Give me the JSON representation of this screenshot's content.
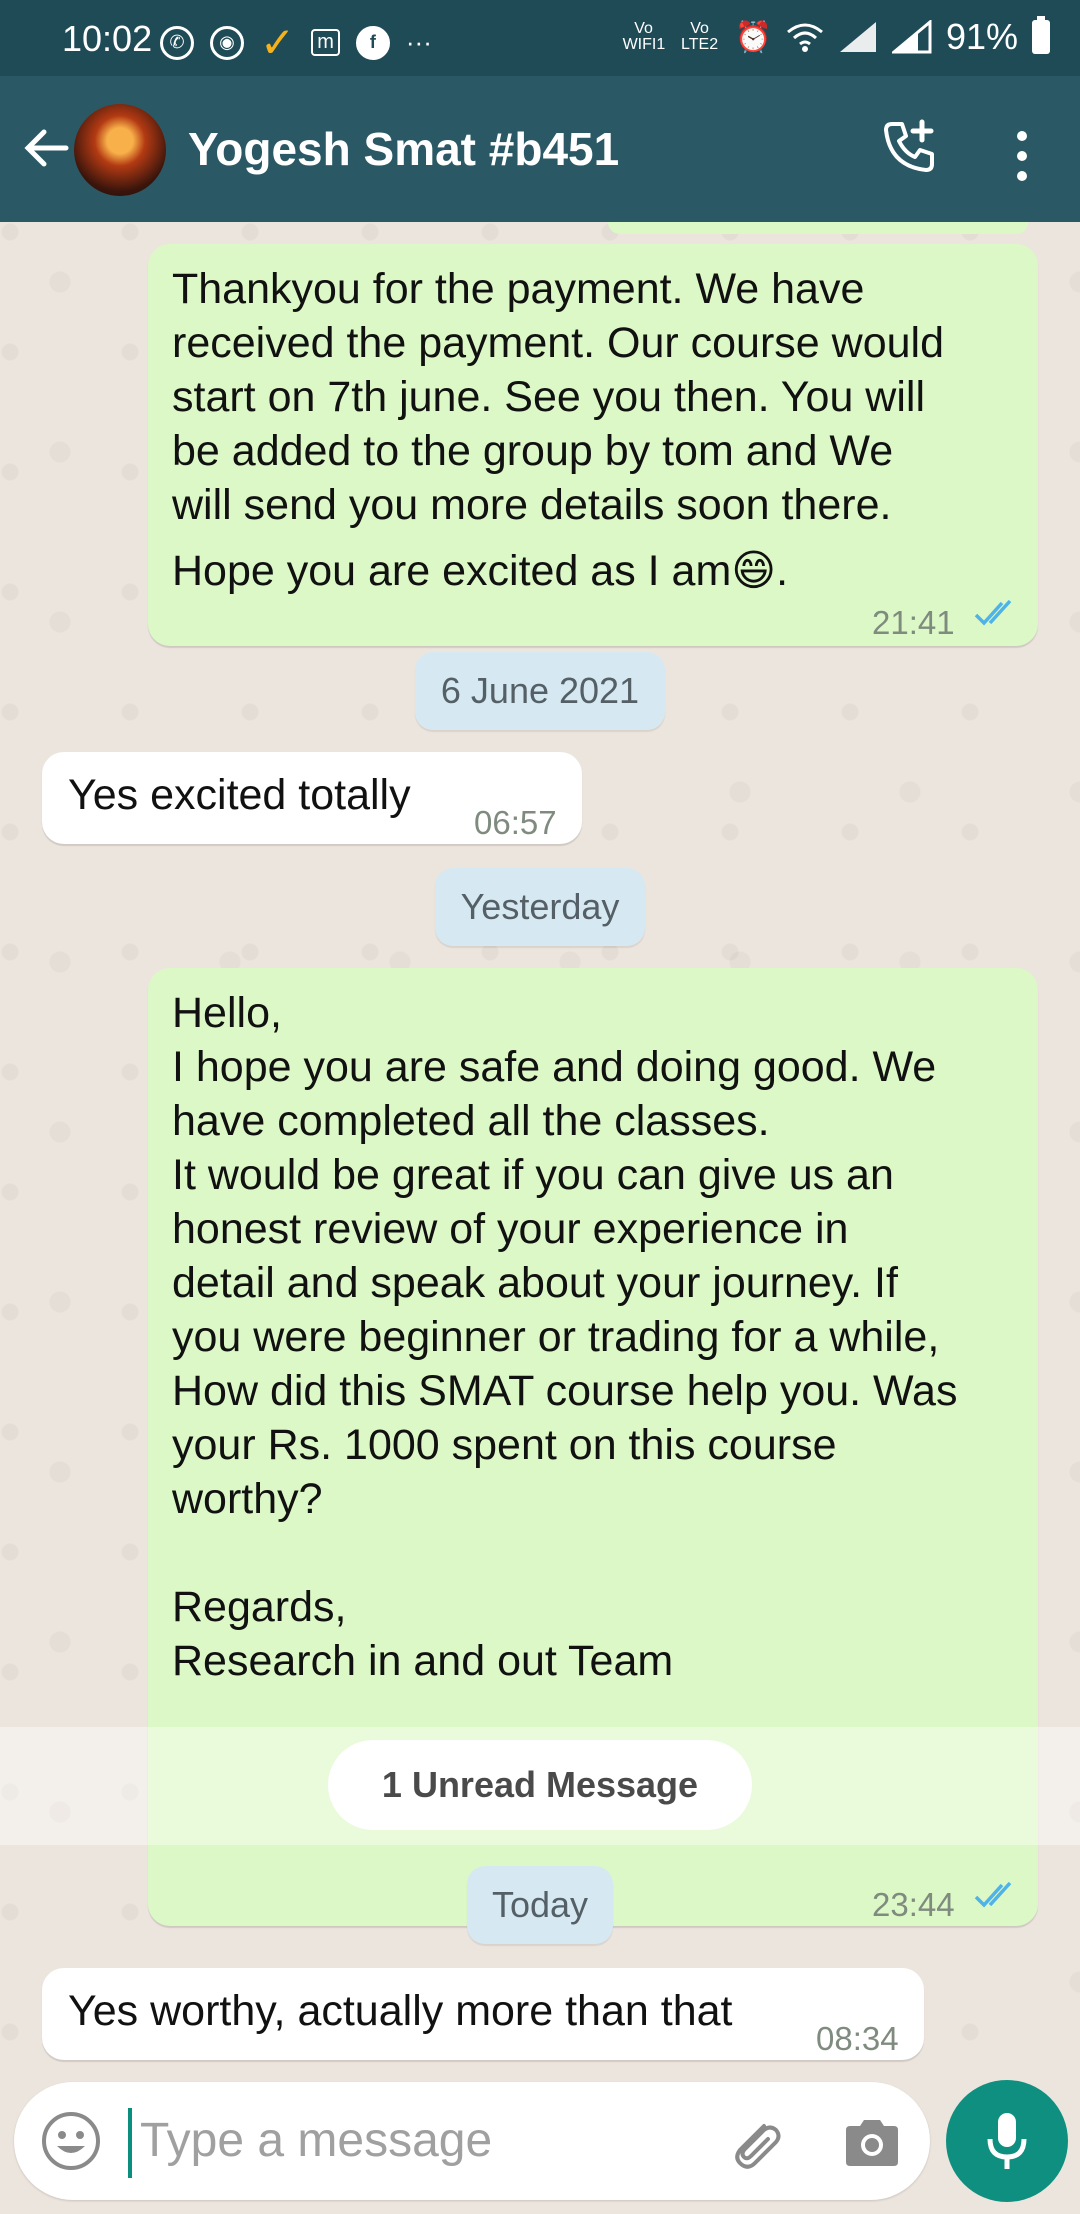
{
  "status_bar": {
    "time": "10:02",
    "battery": "91%",
    "vo_wifi": "Vo WIFI1",
    "vo_lte": "Vo LTE2"
  },
  "header": {
    "contact_name": "Yogesh Smat #b451"
  },
  "messages": [
    {
      "direction": "outgoing",
      "lines": [
        "Thankyou for the payment. We have",
        "received the payment. Our course would",
        "start on 7th june. See you then. You will",
        "be added to the group by tom and We",
        "will send you more details soon there.",
        "Hope you are excited as I am😄."
      ],
      "time": "21:41"
    },
    {
      "direction": "incoming",
      "text": "Yes excited totally",
      "time": "06:57"
    },
    {
      "direction": "outgoing",
      "lines": [
        "Hello,",
        "I hope you are safe and doing good. We",
        "have completed all the classes.",
        "It would be great if you can give us an",
        "honest review of your experience in",
        "detail and speak about your journey. If",
        "you were beginner or trading for a while,",
        "How did this SMAT course help you. Was",
        "your Rs. 1000 spent on this course",
        "worthy?",
        "",
        "Regards,",
        "Research in and out Team"
      ],
      "time": "23:44"
    },
    {
      "direction": "incoming",
      "text": "Yes worthy, actually more than that",
      "time": "08:34"
    }
  ],
  "dates": {
    "d1": "6 June 2021",
    "d2": "Yesterday",
    "d3": "Today"
  },
  "unread_label": "1 Unread Message",
  "composer": {
    "placeholder": "Type a message"
  },
  "colors": {
    "appbar": "#2a5965",
    "outgoing_bubble": "#dcf8c6",
    "read_ticks": "#4fb3e8",
    "mic_button": "#0f8f7f"
  }
}
